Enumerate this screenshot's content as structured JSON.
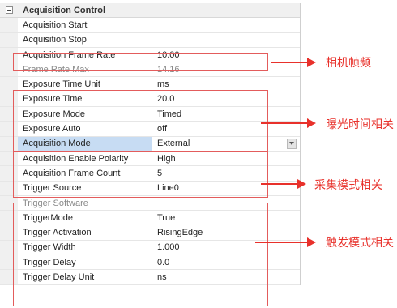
{
  "category": {
    "label": "Acquisition Control"
  },
  "rows": [
    {
      "name": "Acquisition Start",
      "value": ""
    },
    {
      "name": "Acquisition Stop",
      "value": ""
    },
    {
      "name": "Acquisition Frame Rate",
      "value": "10.00"
    },
    {
      "name": "Frame Rate Max",
      "value": "14.16"
    },
    {
      "name": "Exposure Time Unit",
      "value": "ms"
    },
    {
      "name": "Exposure Time",
      "value": "20.0"
    },
    {
      "name": "Exposure Mode",
      "value": "Timed"
    },
    {
      "name": "Exposure Auto",
      "value": "off"
    },
    {
      "name": "Acquisition Mode",
      "value": "External"
    },
    {
      "name": "Acquisition Enable Polarity",
      "value": "High"
    },
    {
      "name": "Acquisition Frame Count",
      "value": "5"
    },
    {
      "name": "Trigger Source",
      "value": "Line0"
    },
    {
      "name": "Trigger Software",
      "value": ""
    },
    {
      "name": "TriggerMode",
      "value": "True"
    },
    {
      "name": "Trigger Activation",
      "value": "RisingEdge"
    },
    {
      "name": "Trigger Width",
      "value": "1.000"
    },
    {
      "name": "Trigger Delay",
      "value": "0.0"
    },
    {
      "name": "Trigger Delay Unit",
      "value": "ns"
    }
  ],
  "annotations": {
    "frame_rate": "相机帧频",
    "exposure": "曝光时间相关",
    "acquisition_mode": "采集模式相关",
    "trigger": "触发模式相关"
  },
  "icons": {
    "collapse": "minus-box-icon",
    "dropdown": "chevron-down-icon"
  },
  "colors": {
    "annotation": "#e8312b",
    "selected_row": "#c7dcf3",
    "disabled_text": "#8a8a8a"
  }
}
